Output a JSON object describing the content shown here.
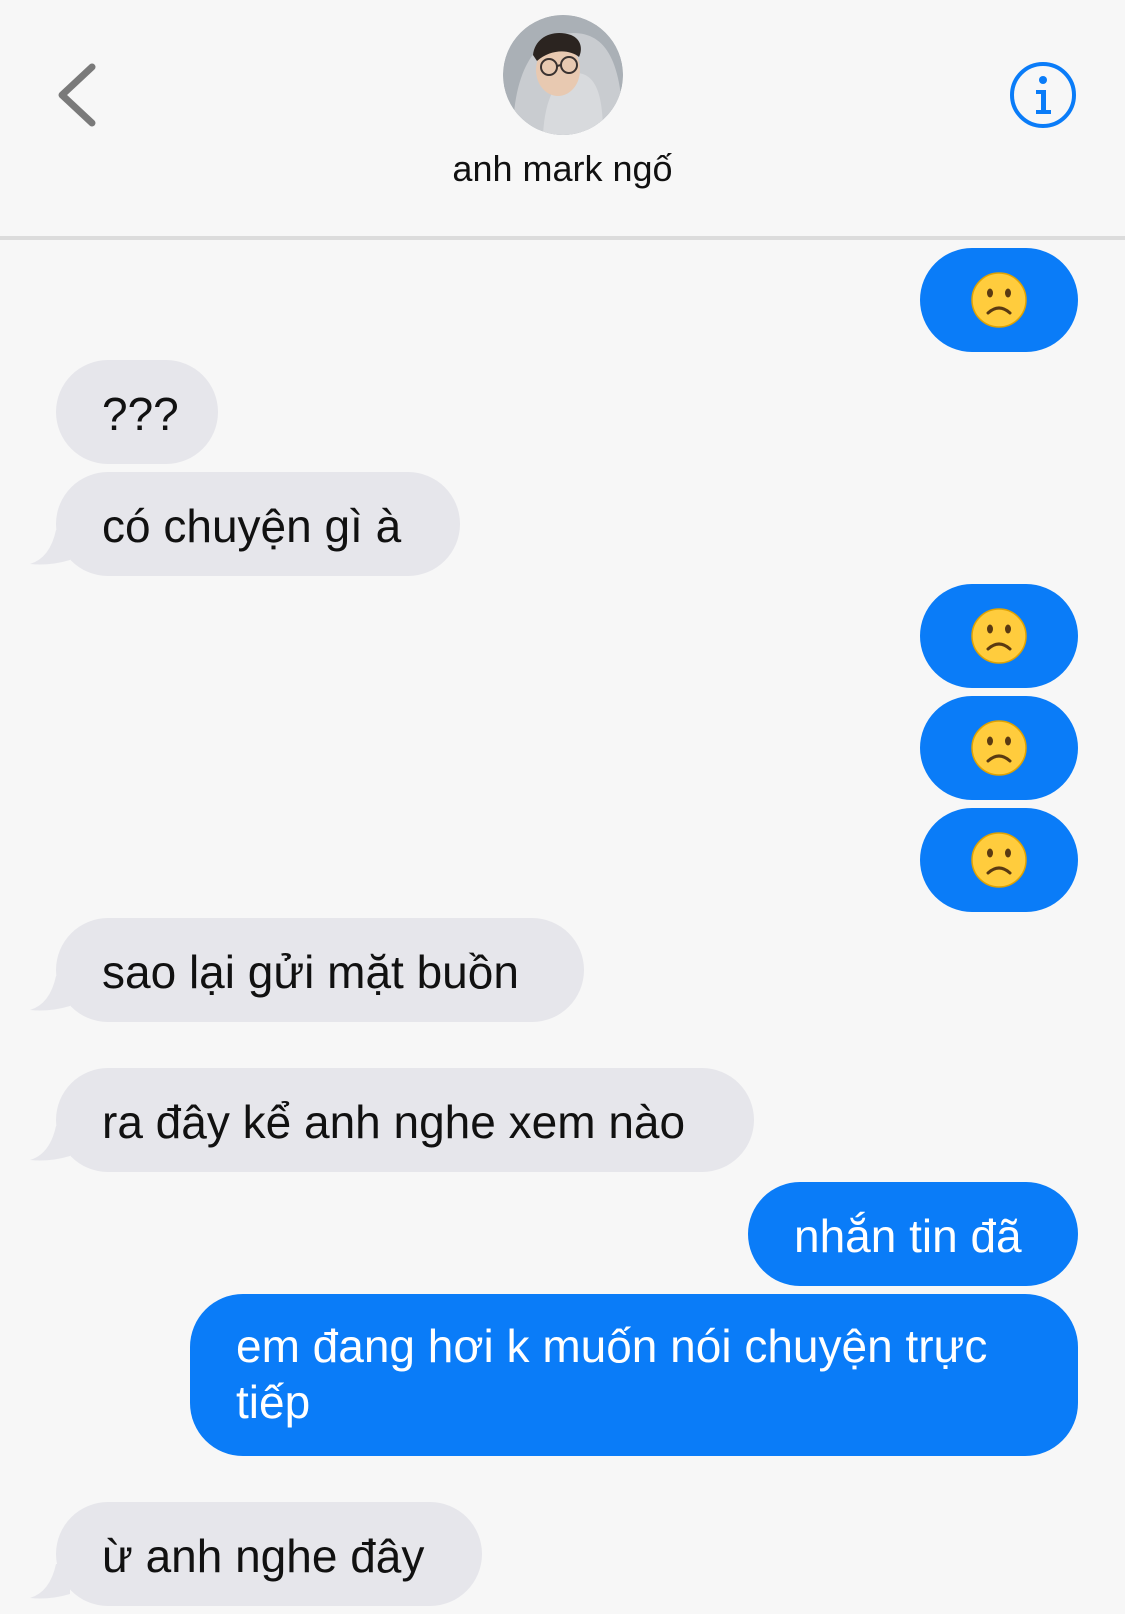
{
  "header": {
    "contact_name": "anh mark ngố",
    "back_icon": "chevron-left-icon",
    "info_icon": "info-icon",
    "accent_color": "#0a7cf8"
  },
  "messages": [
    {
      "from": "me",
      "text": "☹️"
    },
    {
      "from": "them",
      "text": "???"
    },
    {
      "from": "them",
      "text": "có chuyện gì à"
    },
    {
      "from": "me",
      "text": "☹️"
    },
    {
      "from": "me",
      "text": "☹️"
    },
    {
      "from": "me",
      "text": "☹️"
    },
    {
      "from": "them",
      "text": "sao lại gửi mặt buồn"
    },
    {
      "from": "them",
      "text": "ra đây kể anh nghe xem nào"
    },
    {
      "from": "me",
      "text": "nhắn tin đã"
    },
    {
      "from": "me",
      "text": "em đang hơi k muốn nói chuyện trực tiếp"
    },
    {
      "from": "them",
      "text": "ừ anh nghe đây"
    }
  ],
  "colors": {
    "incoming_bubble": "#e6e6eb",
    "outgoing_bubble": "#0a7cf8"
  }
}
